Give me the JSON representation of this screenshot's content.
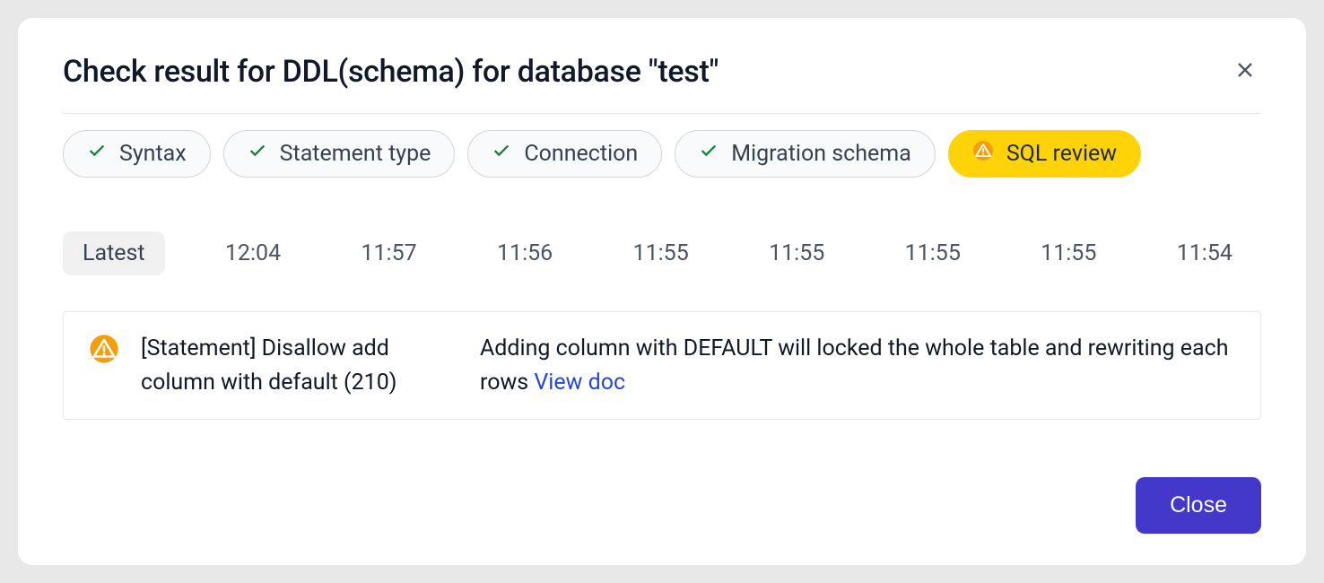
{
  "header": {
    "title": "Check result for DDL(schema) for database \"test\""
  },
  "pills": [
    {
      "label": "Syntax",
      "status": "ok"
    },
    {
      "label": "Statement type",
      "status": "ok"
    },
    {
      "label": "Connection",
      "status": "ok"
    },
    {
      "label": "Migration schema",
      "status": "ok"
    },
    {
      "label": "SQL review",
      "status": "warning"
    }
  ],
  "timestamps": {
    "items": [
      "Latest",
      "12:04",
      "11:57",
      "11:56",
      "11:55",
      "11:55",
      "11:55",
      "11:55",
      "11:54"
    ],
    "active_index": 0
  },
  "result": {
    "title": "[Statement] Disallow add column with default (210)",
    "description": "Adding column with DEFAULT will locked the whole table and rewriting each rows ",
    "link_label": "View doc"
  },
  "footer": {
    "close_label": "Close"
  }
}
